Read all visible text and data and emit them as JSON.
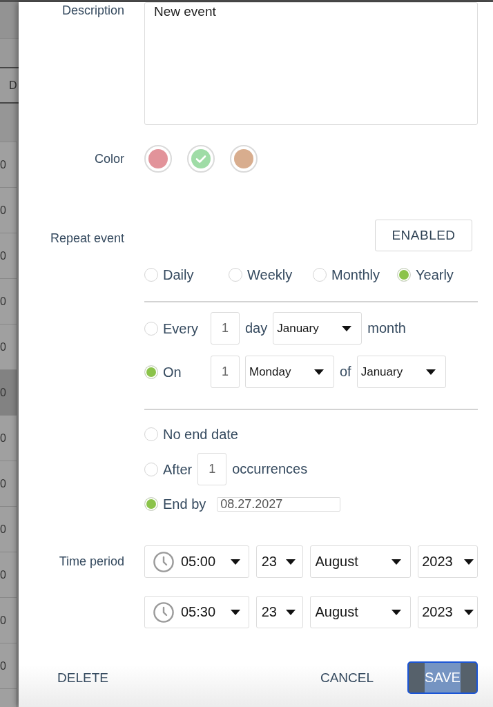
{
  "backdrop": {
    "header": "D",
    "rows": [
      {
        "text": "0",
        "highlighted": false
      },
      {
        "text": "0",
        "highlighted": false
      },
      {
        "text": "0",
        "highlighted": false
      },
      {
        "text": "0",
        "highlighted": false
      },
      {
        "text": "0",
        "highlighted": false
      },
      {
        "text": "0",
        "highlighted": true
      },
      {
        "text": "0",
        "highlighted": false
      },
      {
        "text": "0",
        "highlighted": false
      },
      {
        "text": "0",
        "highlighted": false
      },
      {
        "text": "0",
        "highlighted": false
      },
      {
        "text": "0",
        "highlighted": false
      },
      {
        "text": "0",
        "highlighted": false
      }
    ]
  },
  "description": {
    "label": "Description",
    "value": "New event"
  },
  "color": {
    "label": "Color",
    "options": [
      {
        "color": "#e2939a",
        "selected": false
      },
      {
        "color": "#9fdca6",
        "selected": true
      },
      {
        "color": "#d8ad8e",
        "selected": false
      }
    ]
  },
  "repeat": {
    "label": "Repeat event",
    "toggle": "ENABLED",
    "frequencies": [
      {
        "label": "Daily",
        "selected": false
      },
      {
        "label": "Weekly",
        "selected": false
      },
      {
        "label": "Monthly",
        "selected": false
      },
      {
        "label": "Yearly",
        "selected": true
      }
    ],
    "pattern": [
      {
        "label": "Every",
        "selected": false,
        "parts": [
          {
            "kind": "number",
            "value": "1"
          },
          {
            "kind": "text",
            "text": "day"
          },
          {
            "kind": "select",
            "value": "January"
          },
          {
            "kind": "text",
            "text": "month"
          }
        ]
      },
      {
        "label": "On",
        "selected": true,
        "parts": [
          {
            "kind": "number",
            "value": "1"
          },
          {
            "kind": "select",
            "value": "Monday"
          },
          {
            "kind": "text",
            "text": "of"
          },
          {
            "kind": "select",
            "value": "January"
          }
        ]
      }
    ],
    "end": [
      {
        "label": "No end date",
        "selected": false
      },
      {
        "label": "After",
        "selected": false,
        "parts": [
          {
            "kind": "number",
            "value": "1"
          },
          {
            "kind": "text",
            "text": "occurrences"
          }
        ]
      },
      {
        "label": "End by",
        "selected": true,
        "parts": [
          {
            "kind": "date",
            "value": "08.27.2027"
          }
        ]
      }
    ]
  },
  "time_period": {
    "label": "Time period",
    "rows": [
      {
        "time": "05:00",
        "day": "23",
        "month": "August",
        "year": "2023"
      },
      {
        "time": "05:30",
        "day": "23",
        "month": "August",
        "year": "2023"
      }
    ]
  },
  "buttons": [
    {
      "kind": "text",
      "label": "DELETE"
    },
    {
      "kind": "text",
      "label": "CANCEL"
    },
    {
      "kind": "primary",
      "label": "SAVE",
      "focused": true,
      "highlighted": true
    }
  ]
}
